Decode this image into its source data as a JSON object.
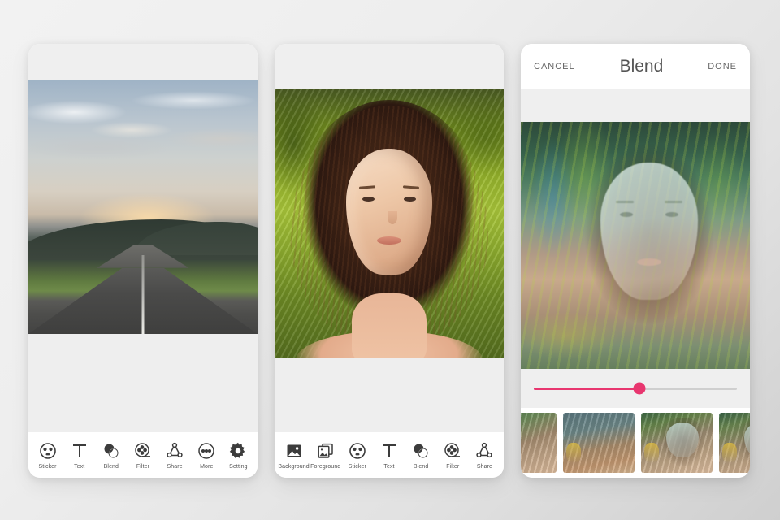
{
  "app": {
    "accent_color": "#e8366f",
    "icon_color": "#3c3c3c",
    "background_color": "#eeeeee"
  },
  "phone1": {
    "name": "editor-home-screen",
    "photo_alt": "Empty countryside road leading toward mountains at sunset",
    "toolbar": [
      {
        "label": "Sticker",
        "icon": "sticker-face-icon"
      },
      {
        "label": "Text",
        "icon": "text-t-icon"
      },
      {
        "label": "Blend",
        "icon": "blend-circles-icon"
      },
      {
        "label": "Filter",
        "icon": "filter-film-reel-icon"
      },
      {
        "label": "Share",
        "icon": "share-nodes-icon"
      },
      {
        "label": "More",
        "icon": "more-dots-icon"
      },
      {
        "label": "Setting",
        "icon": "settings-gear-icon"
      }
    ]
  },
  "phone2": {
    "name": "blend-picker-screen",
    "photo_alt": "Portrait of a woman with long curly hair over a green vineyard",
    "toolbar": [
      {
        "label": "Background",
        "icon": "background-photo-icon"
      },
      {
        "label": "Foreground",
        "icon": "foreground-photos-icon"
      },
      {
        "label": "Sticker",
        "icon": "sticker-face-icon"
      },
      {
        "label": "Text",
        "icon": "text-t-icon"
      },
      {
        "label": "Blend",
        "icon": "blend-circles-icon"
      },
      {
        "label": "Filter",
        "icon": "filter-film-reel-icon"
      },
      {
        "label": "Share",
        "icon": "share-nodes-icon"
      }
    ]
  },
  "phone3": {
    "name": "blend-edit-screen",
    "nav": {
      "cancel_label": "CANCEL",
      "title": "Blend",
      "done_label": "DONE"
    },
    "photo_alt": "Double-exposure blend of the portrait over tropical foliage",
    "slider": {
      "name": "blend-opacity-slider",
      "value_percent": 52,
      "min": 0,
      "max": 100
    },
    "thumbnails": [
      {
        "label": "blend-preset-1",
        "selected": false
      },
      {
        "label": "blend-preset-2",
        "selected": false
      },
      {
        "label": "blend-preset-3",
        "selected": true
      },
      {
        "label": "blend-preset-4",
        "selected": false
      }
    ]
  }
}
